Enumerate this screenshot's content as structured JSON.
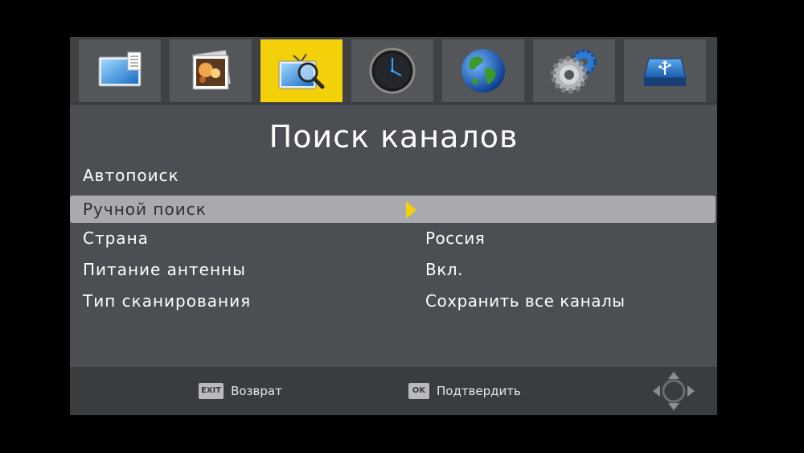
{
  "tabs": [
    {
      "icon": "tv-picture-icon",
      "active": false
    },
    {
      "icon": "photo-icon",
      "active": false
    },
    {
      "icon": "channel-search-icon",
      "active": true
    },
    {
      "icon": "clock-icon",
      "active": false
    },
    {
      "icon": "globe-icon",
      "active": false
    },
    {
      "icon": "settings-gears-icon",
      "active": false
    },
    {
      "icon": "usb-drive-icon",
      "active": false
    }
  ],
  "panel": {
    "title": "Поиск каналов",
    "items": [
      {
        "label": "Автопоиск",
        "value": ""
      },
      {
        "label": "Ручной поиск",
        "value": "",
        "selected": true
      },
      {
        "label": "Страна",
        "value": "Россия"
      },
      {
        "label": "Питание антенны",
        "value": "Вкл."
      },
      {
        "label": "Тип сканирования",
        "value": "Сохранить все каналы"
      }
    ]
  },
  "footer": {
    "exit_key": "EXIT",
    "exit_label": "Возврат",
    "ok_key": "OK",
    "ok_label": "Подтвердить"
  },
  "colors": {
    "accent": "#f4d00a",
    "selected_row": "#a8aab0",
    "panel": "#4b4e52"
  }
}
